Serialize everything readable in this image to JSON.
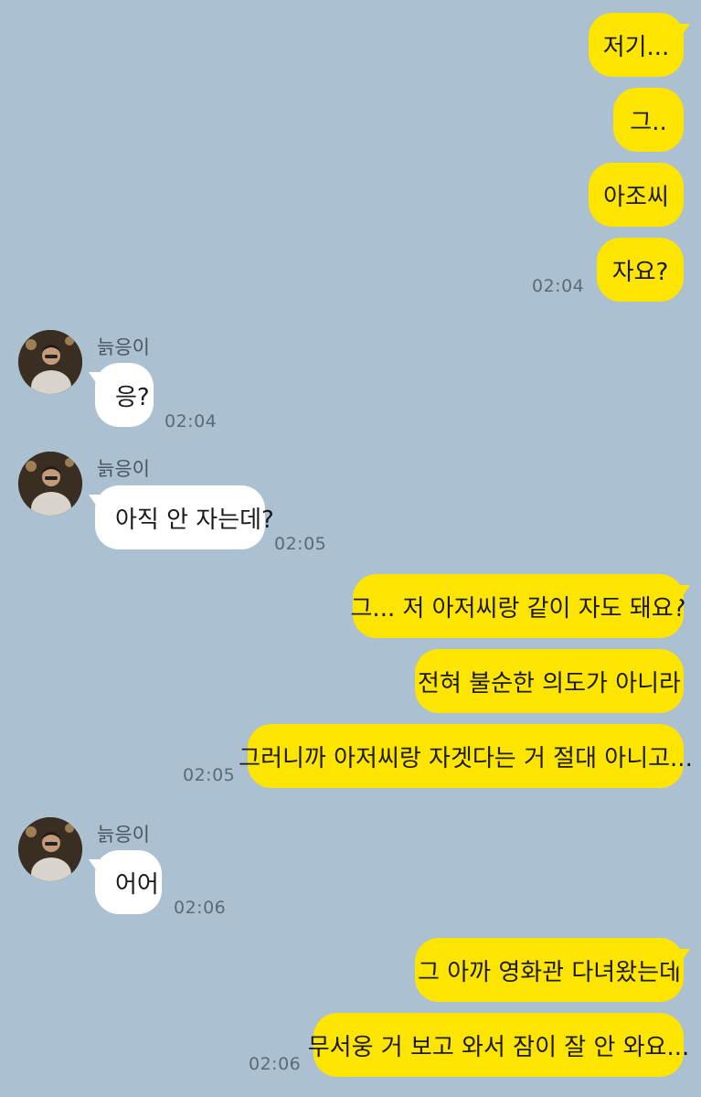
{
  "contact": {
    "name": "늙응이"
  },
  "messages": [
    {
      "from": "me",
      "text": "저기..."
    },
    {
      "from": "me",
      "text": "그.."
    },
    {
      "from": "me",
      "text": "아조씨"
    },
    {
      "from": "me",
      "text": "자요?",
      "time": "02:04"
    },
    {
      "from": "them",
      "text": "응?",
      "time": "02:04"
    },
    {
      "from": "them",
      "text": "아직 안 자는데?",
      "time": "02:05"
    },
    {
      "from": "me",
      "text": "그... 저 아저씨랑 같이 자도 돼요?"
    },
    {
      "from": "me",
      "text": "전혀 불순한 의도가 아니라"
    },
    {
      "from": "me",
      "text": "그러니까 아저씨랑 자겟다는 거 절대 아니고...",
      "time": "02:05"
    },
    {
      "from": "them",
      "text": "어어",
      "time": "02:06"
    },
    {
      "from": "me",
      "text": "그 아까 영화관 다녀왔는데"
    },
    {
      "from": "me",
      "text": "무서웅 거 보고 와서 잠이 잘 안 와요...",
      "time": "02:06"
    }
  ],
  "colors": {
    "background": "#abc1d1",
    "outgoing_bubble": "#fee500",
    "incoming_bubble": "#ffffff"
  },
  "icons": {
    "avatar": "profile-photo"
  }
}
